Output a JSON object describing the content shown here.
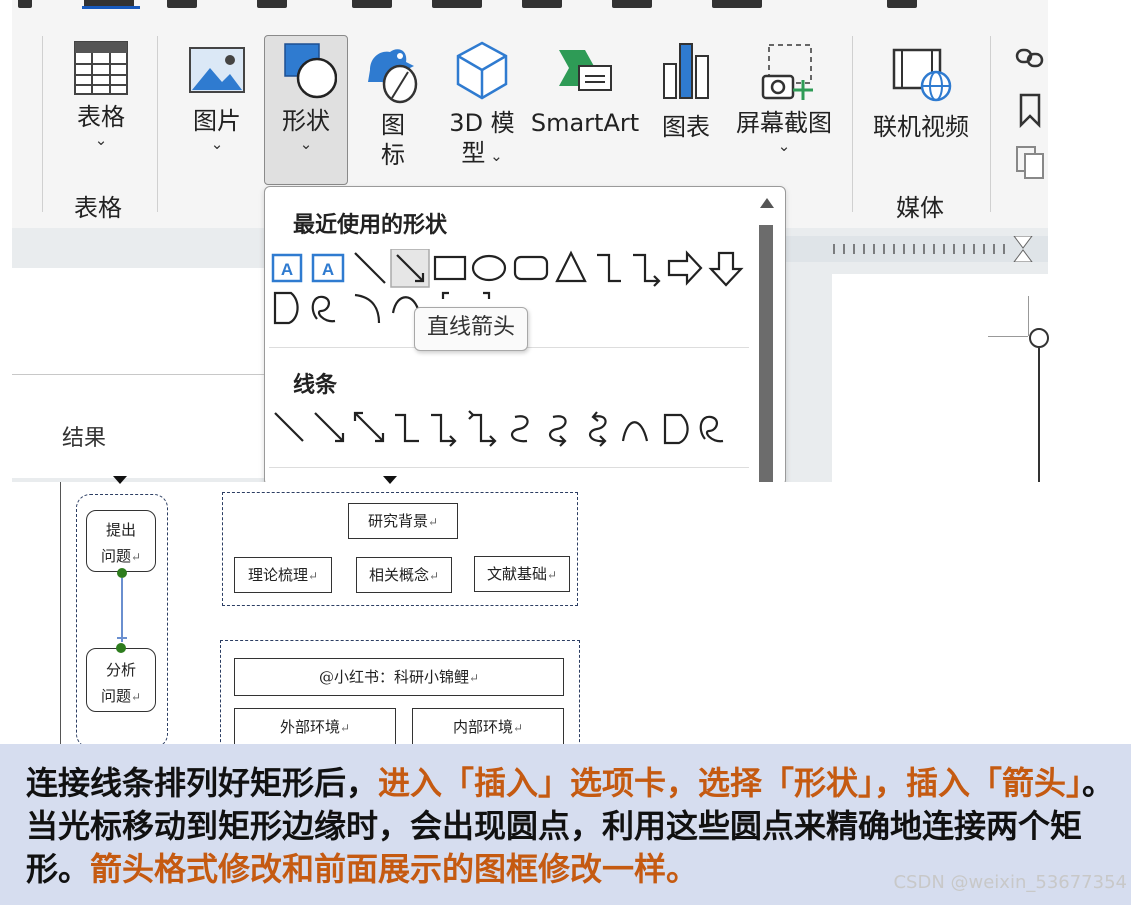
{
  "ribbon": {
    "groups": [
      {
        "name": "表格",
        "buttons": [
          {
            "label": "表格",
            "has_dropdown": true,
            "icon": "table-icon"
          }
        ]
      },
      {
        "name": "",
        "buttons": [
          {
            "label": "图片",
            "has_dropdown": true,
            "icon": "picture-icon"
          },
          {
            "label": "形状",
            "has_dropdown": true,
            "icon": "shapes-icon",
            "selected": true
          },
          {
            "label": "图标",
            "has_dropdown": false,
            "icon": "icons-icon"
          },
          {
            "label": "3D 模型",
            "has_dropdown": true,
            "icon": "3d-model-icon"
          },
          {
            "label": "SmartArt",
            "has_dropdown": false,
            "icon": "smartart-icon"
          },
          {
            "label": "图表",
            "has_dropdown": false,
            "icon": "chart-icon"
          },
          {
            "label": "屏幕截图",
            "has_dropdown": true,
            "icon": "screenshot-icon"
          }
        ]
      },
      {
        "name": "媒体",
        "buttons": [
          {
            "label": "联机视频",
            "has_dropdown": false,
            "icon": "online-video-icon"
          }
        ]
      }
    ],
    "shape_label_line1": "形状",
    "icon_label_line1": "图",
    "icon_label_line2": "标",
    "model_label_line1": "3D 模",
    "model_label_line2": "型"
  },
  "shapes_menu": {
    "recent_header": "最近使用的形状",
    "lines_header": "线条",
    "tooltip": "直线箭头"
  },
  "document": {
    "side_label": "结果"
  },
  "diagram": {
    "left_nodes": [
      "提出\n问题",
      "分析\n问题"
    ],
    "top_group": {
      "title": "研究背景",
      "items": [
        "理论梳理",
        "相关概念",
        "文献基础"
      ]
    },
    "bottom_group": {
      "title": "@小红书：科研小锦鲤",
      "items": [
        "外部环境",
        "内部环境"
      ]
    },
    "return_mark": "↵"
  },
  "caption": {
    "seg1": "连接线条排列好矩形后，",
    "seg2": "进入「插入」选项卡，选择「形状」，插入「箭头」",
    "seg3": "。当光标移动到矩形边缘时，会出现圆点，利用这些圆点来精确地连接两个矩形。",
    "seg4": "箭头格式修改和前面展示的图框修改一样。"
  },
  "watermark": "CSDN @weixin_53677354",
  "colors": {
    "accent": "#185abd",
    "highlight": "#c55a11",
    "caption_bg": "#d6ddef",
    "dot_green": "#2e7d1e"
  }
}
